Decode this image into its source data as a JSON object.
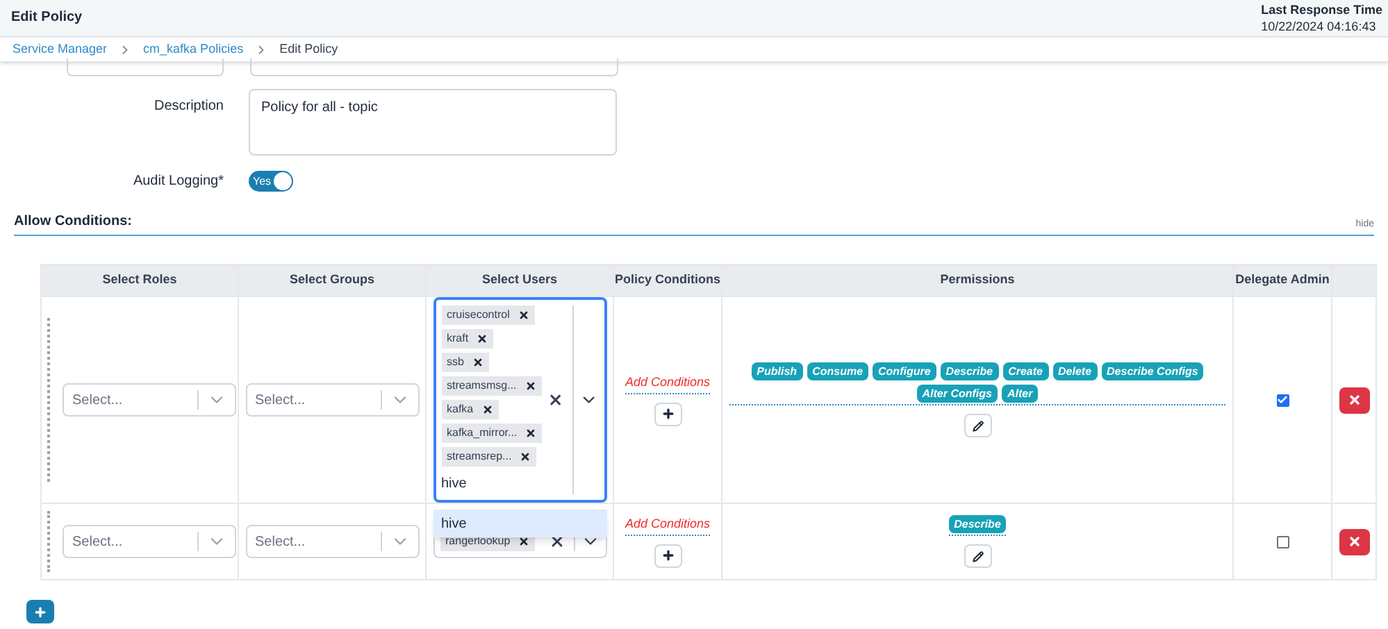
{
  "header": {
    "title": "Edit Policy",
    "response_label": "Last Response Time",
    "response_time": "10/22/2024 04:16:43"
  },
  "breadcrumb": [
    {
      "label": "Service Manager",
      "link": true
    },
    {
      "label": "cm_kafka Policies",
      "link": true
    },
    {
      "label": "Edit Policy",
      "link": false
    }
  ],
  "form": {
    "description_label": "Description",
    "description": "Policy for all - topic",
    "audit_label": "Audit Logging*",
    "audit": {
      "on": true,
      "label": "Yes"
    }
  },
  "section": {
    "title": "Allow Conditions:",
    "toggle": "hide"
  },
  "table": {
    "columns": [
      "Select Roles",
      "Select Groups",
      "Select Users",
      "Policy Conditions",
      "Permissions",
      "Delegate Admin"
    ],
    "rows": [
      {
        "roles_placeholder": "Select...",
        "groups_placeholder": "Select...",
        "users": [
          "cruisecontrol",
          "kraft",
          "ssb",
          "streamsmsg...",
          "kafka",
          "kafka_mirror...",
          "streamsrep..."
        ],
        "users_input": "hive",
        "focused": true,
        "add_conditions": "Add Conditions",
        "permissions": [
          "Publish",
          "Consume",
          "Configure",
          "Describe",
          "Create",
          "Delete",
          "Describe Configs",
          "Alter Configs",
          "Alter"
        ],
        "delegate_admin": true
      },
      {
        "roles_placeholder": "Select...",
        "groups_placeholder": "Select...",
        "users": [
          "rangerlookup"
        ],
        "focused": false,
        "add_conditions": "Add Conditions",
        "permissions": [
          "Describe"
        ],
        "delegate_admin": false
      }
    ]
  },
  "dropdown": {
    "options": [
      {
        "label": "hive",
        "selected": true
      }
    ]
  }
}
